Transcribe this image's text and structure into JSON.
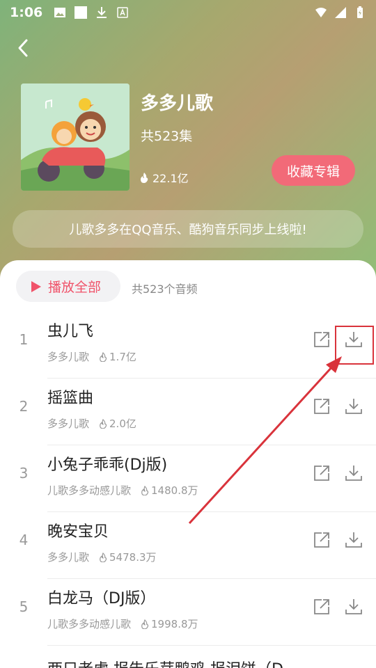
{
  "status_bar": {
    "time": "1:06"
  },
  "album": {
    "title": "多多儿歌",
    "count": "共523集",
    "plays": "22.1亿",
    "collect_label": "收藏专辑",
    "notice": "儿歌多多在QQ音乐、酷狗音乐同步上线啦!"
  },
  "list": {
    "play_all_label": "播放全部",
    "total_label": "共523个音频",
    "songs": [
      {
        "index": "1",
        "name": "虫儿飞",
        "artist": "多多儿歌",
        "plays": "1.7亿"
      },
      {
        "index": "2",
        "name": "摇篮曲",
        "artist": "多多儿歌",
        "plays": "2.0亿"
      },
      {
        "index": "3",
        "name": "小兔子乖乖(Dj版)",
        "artist": "儿歌多多动感儿歌",
        "plays": "1480.8万"
      },
      {
        "index": "4",
        "name": "晚安宝贝",
        "artist": "多多儿歌",
        "plays": "5478.3万"
      },
      {
        "index": "5",
        "name": "白龙马（DJ版）",
        "artist": "儿歌多多动感儿歌",
        "plays": "1998.8万"
      }
    ],
    "partial_next": "两只老虎 报告乐芽鸭鸡 报泪饼（D"
  },
  "colors": {
    "accent": "#f26a78",
    "play_accent": "#f0536a",
    "annotation": "#d9333b"
  }
}
